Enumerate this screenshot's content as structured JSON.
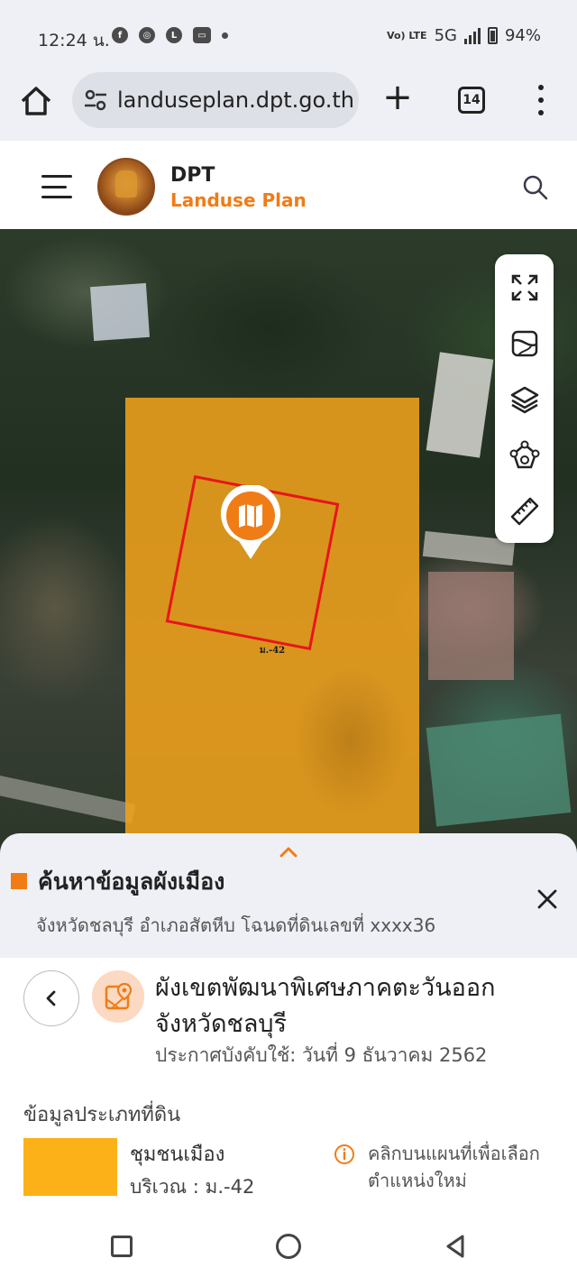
{
  "status_bar": {
    "time": "12:24 น.",
    "apps": [
      "facebook-icon",
      "chrome-icon",
      "line-icon",
      "lineman-icon",
      "dot-icon"
    ],
    "network_label": "Vo) LTE",
    "network": "5G",
    "battery": "94%"
  },
  "browser": {
    "url": "landuseplan.dpt.go.th",
    "tab_count": "14"
  },
  "site": {
    "brand_title": "DPT",
    "brand_subtitle": "Landuse Plan",
    "accent_color": "#f07c16"
  },
  "map": {
    "parcel_label": "ม.-42",
    "zone_color": "#f0a21c",
    "parcel_border_color": "#e8151a",
    "tools": [
      "fullscreen-icon",
      "basemap-icon",
      "layers-icon",
      "measure-area-icon",
      "ruler-icon"
    ]
  },
  "sheet": {
    "title": "ค้นหาข้อมูลผังเมือง",
    "subtitle": "จังหวัดชลบุรี อำเภอสัตหีบ โฉนดที่ดินเลขที่ xxxx36"
  },
  "plan": {
    "title": "ผังเขตพัฒนาพิเศษภาคตะวันออก จังหวัดชลบุรี",
    "effective_date": "ประกาศบังคับใช้: วันที่ 9 ธันวาคม 2562"
  },
  "land": {
    "heading": "ข้อมูลประเภทที่ดิน",
    "name": "ชุมชนเมือง",
    "area": "บริเวณ : ม.-42",
    "swatch_color": "#fbb117",
    "hint": "คลิกบนแผนที่เพื่อเลือกตำแหน่งใหม่"
  }
}
